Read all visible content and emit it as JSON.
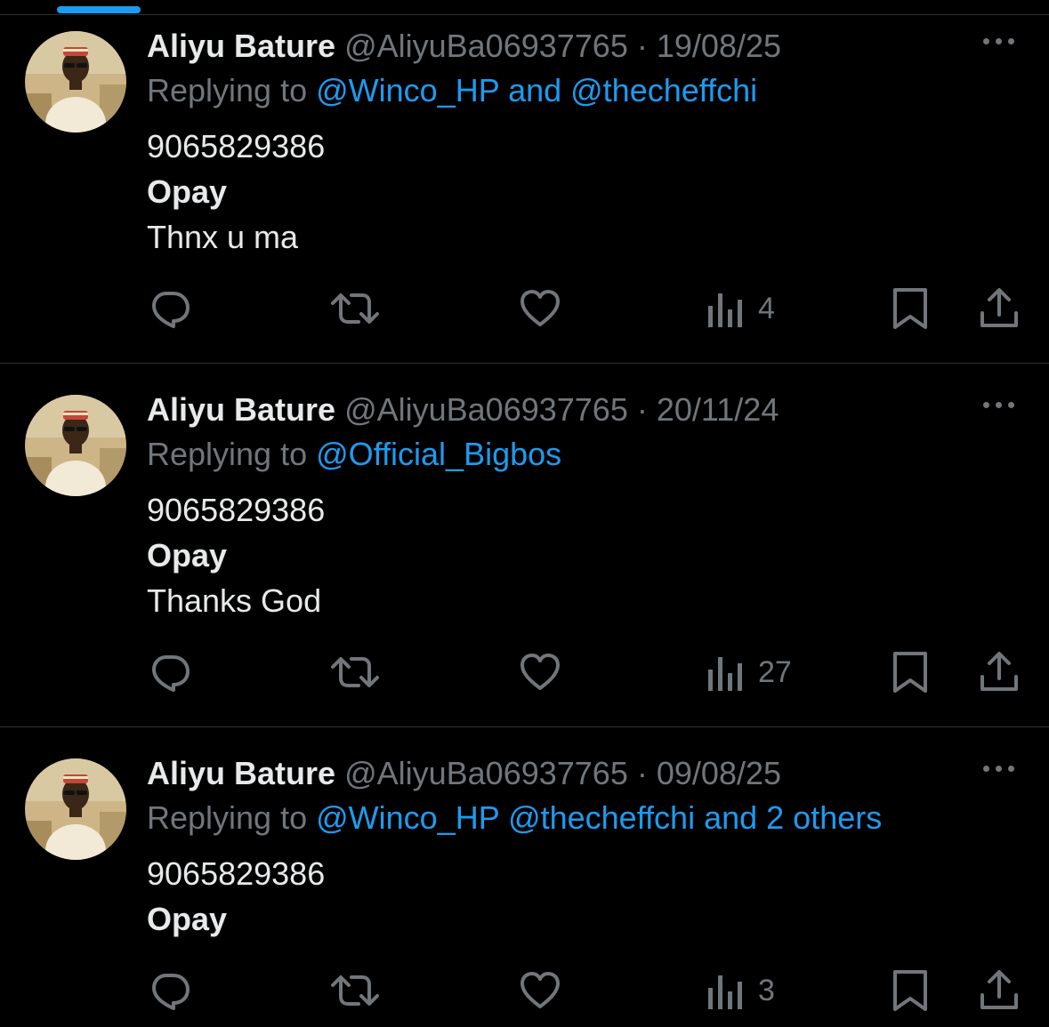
{
  "theme": {
    "background": "#000000",
    "text": "#e7e9ea",
    "muted": "#71767b",
    "accent": "#1d9bf0",
    "divider": "#2f3336"
  },
  "tweets": [
    {
      "name": "Aliyu Bature",
      "handle": "@AliyuBa06937765",
      "separator": "·",
      "date": "19/08/25",
      "replying_prefix": "Replying to",
      "replying_to": "@Winco_HP and @thecheffchi",
      "lines": [
        "9065829386",
        "Opay",
        "Thnx u ma"
      ],
      "views": "4",
      "icons": [
        "reply-icon",
        "retweet-icon",
        "like-icon",
        "views-icon",
        "bookmark-icon",
        "share-icon"
      ]
    },
    {
      "name": "Aliyu Bature",
      "handle": "@AliyuBa06937765",
      "separator": "·",
      "date": "20/11/24",
      "replying_prefix": "Replying to",
      "replying_to": "@Official_Bigbos",
      "lines": [
        "9065829386",
        "Opay",
        "Thanks God"
      ],
      "views": "27",
      "icons": [
        "reply-icon",
        "retweet-icon",
        "like-icon",
        "views-icon",
        "bookmark-icon",
        "share-icon"
      ]
    },
    {
      "name": "Aliyu Bature",
      "handle": "@AliyuBa06937765",
      "separator": "·",
      "date": "09/08/25",
      "replying_prefix": "Replying to",
      "replying_to": "@Winco_HP @thecheffchi and 2 others",
      "lines": [
        "9065829386",
        "Opay"
      ],
      "views": "3",
      "icons": [
        "reply-icon",
        "retweet-icon",
        "like-icon",
        "views-icon",
        "bookmark-icon",
        "share-icon"
      ]
    }
  ]
}
